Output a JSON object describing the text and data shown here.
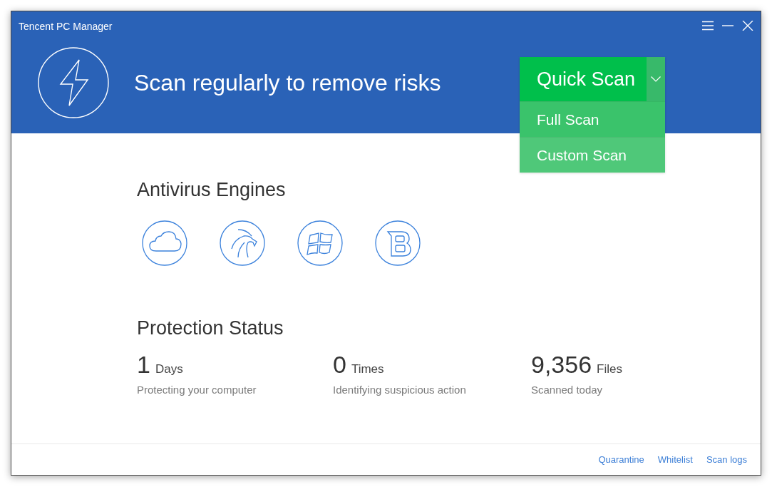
{
  "window": {
    "title": "Tencent PC Manager"
  },
  "header": {
    "headline": "Scan regularly to remove risks"
  },
  "scan_button": {
    "label": "Quick Scan",
    "expanded": true
  },
  "scan_menu": [
    {
      "label": "Full Scan"
    },
    {
      "label": "Custom Scan"
    }
  ],
  "engines": {
    "title": "Antivirus Engines"
  },
  "protection": {
    "title": "Protection Status",
    "stats": [
      {
        "value": "1",
        "unit": "Days",
        "caption": "Protecting your computer"
      },
      {
        "value": "0",
        "unit": "Times",
        "caption": "Identifying suspicious action"
      },
      {
        "value": "9,356",
        "unit": "Files",
        "caption": "Scanned today"
      }
    ]
  },
  "footer_links": [
    "Quarantine",
    "Whitelist",
    "Scan logs"
  ]
}
